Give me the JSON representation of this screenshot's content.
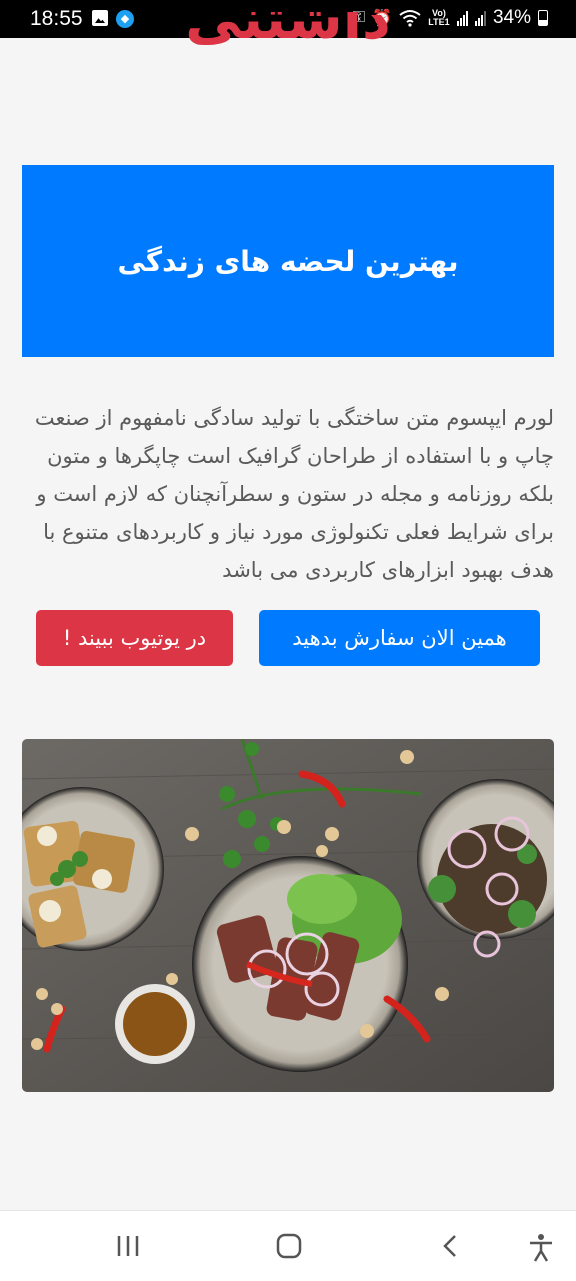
{
  "status_bar": {
    "time": "18:55",
    "battery": "34%",
    "network_label": "Vo) LTE1"
  },
  "brand": {
    "title": "داشتنی"
  },
  "hero": {
    "heading": "بهترین لحضه های زندگی"
  },
  "description": "لورم ایپسوم متن ساختگی با تولید سادگی نامفهوم از صنعت چاپ و با استفاده از طراحان گرافیک است چاپگرها و متون بلکه روزنامه و مجله در ستون و سطرآنچنان که لازم است و برای شرایط فعلی تکنولوژی مورد نیاز و کاربردهای متنوع با هدف بهبود ابزارهای کاربردی می باشد",
  "buttons": {
    "order_now": "همین الان سفارش بدهید",
    "watch_youtube": "در یوتیوب ببیند !"
  },
  "colors": {
    "primary": "#007bff",
    "danger": "#dc3545",
    "background": "#f5f5f5"
  },
  "nav_bar": {
    "icons": [
      "recent-apps-icon",
      "home-icon",
      "back-icon",
      "accessibility-icon"
    ]
  }
}
